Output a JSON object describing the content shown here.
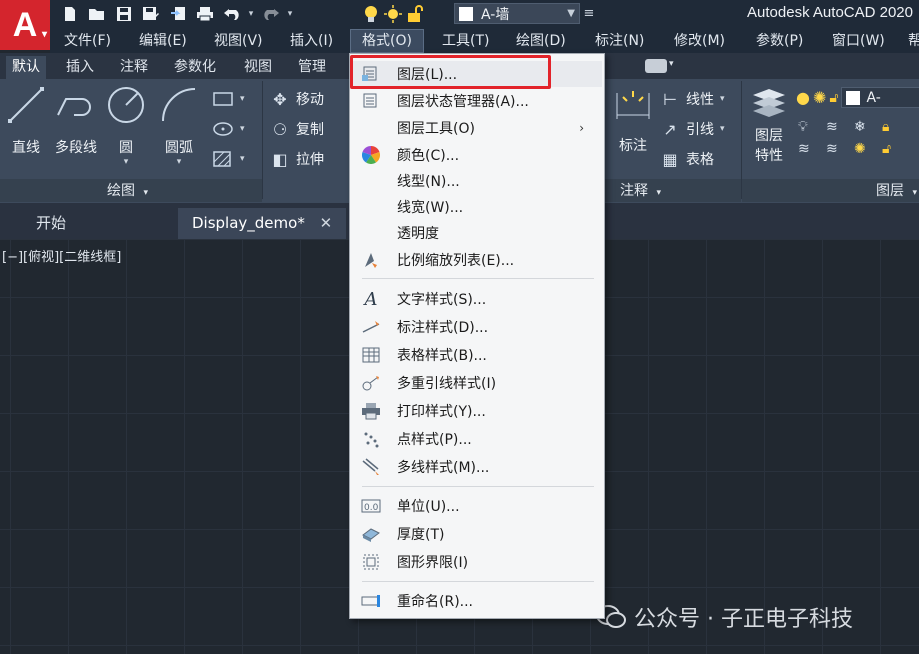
{
  "app": {
    "title": "Autodesk AutoCAD 2020",
    "logo_letter": "A",
    "layer_current": "A-墙",
    "brand_color": "#d4252d"
  },
  "quick_access": [
    "new-icon",
    "open-icon",
    "save-icon",
    "saveas-icon",
    "publish-icon",
    "print-icon",
    "undo-icon",
    "redo-icon"
  ],
  "menubar": {
    "items": [
      "文件(F)",
      "编辑(E)",
      "视图(V)",
      "插入(I)",
      "格式(O)",
      "工具(T)",
      "绘图(D)",
      "标注(N)",
      "修改(M)",
      "参数(P)",
      "窗口(W)",
      "帮"
    ],
    "active": "格式(O)"
  },
  "ribbon_tabs": {
    "items": [
      "默认",
      "插入",
      "注释",
      "参数化",
      "视图",
      "管理"
    ],
    "active": "默认"
  },
  "ribbon": {
    "draw_panel": {
      "label": "绘图",
      "tools": [
        "直线",
        "多段线",
        "圆",
        "圆弧"
      ]
    },
    "modify_tools": [
      "移动",
      "复制",
      "拉伸"
    ],
    "annotation_panel": {
      "label": "注释",
      "tools": [
        "标注",
        "线性",
        "引线",
        "表格"
      ]
    },
    "layers_panel": {
      "label": "图层",
      "tool": "图层",
      "tool2": "特性",
      "layer_name": "A-"
    }
  },
  "document_tabs": {
    "items": [
      {
        "label": "开始"
      },
      {
        "label": "Display_demo*"
      }
    ],
    "close_glyph": "✕"
  },
  "viewport": {
    "label": "[−][俯视][二维线框]"
  },
  "format_menu": {
    "items": [
      {
        "label": "图层(L)...",
        "icon": "layer-icon",
        "highlighted": true
      },
      {
        "label": "图层状态管理器(A)...",
        "icon": "layer-state-icon"
      },
      {
        "label": "图层工具(O)",
        "icon": "",
        "submenu": true
      },
      {
        "label": "颜色(C)...",
        "icon": "color-wheel-icon"
      },
      {
        "label": "线型(N)...",
        "icon": ""
      },
      {
        "label": "线宽(W)...",
        "icon": ""
      },
      {
        "label": "透明度",
        "icon": ""
      },
      {
        "label": "比例缩放列表(E)...",
        "icon": "scale-list-icon"
      },
      {
        "label": "文字样式(S)...",
        "icon": "text-style-icon"
      },
      {
        "label": "标注样式(D)...",
        "icon": "dim-style-icon"
      },
      {
        "label": "表格样式(B)...",
        "icon": "table-style-icon"
      },
      {
        "label": "多重引线样式(I)",
        "icon": "mleader-style-icon"
      },
      {
        "label": "打印样式(Y)...",
        "icon": "plot-style-icon"
      },
      {
        "label": "点样式(P)...",
        "icon": "point-style-icon"
      },
      {
        "label": "多线样式(M)...",
        "icon": "mline-style-icon"
      },
      {
        "label": "单位(U)...",
        "icon": "units-icon"
      },
      {
        "label": "厚度(T)",
        "icon": "thickness-icon"
      },
      {
        "label": "图形界限(I)",
        "icon": "limits-icon"
      },
      {
        "label": "重命名(R)...",
        "icon": "rename-icon"
      }
    ],
    "submenu_glyph": "›",
    "highlight_color": "#e2232a"
  },
  "watermark": {
    "text": "公众号 · 子正电子科技"
  }
}
